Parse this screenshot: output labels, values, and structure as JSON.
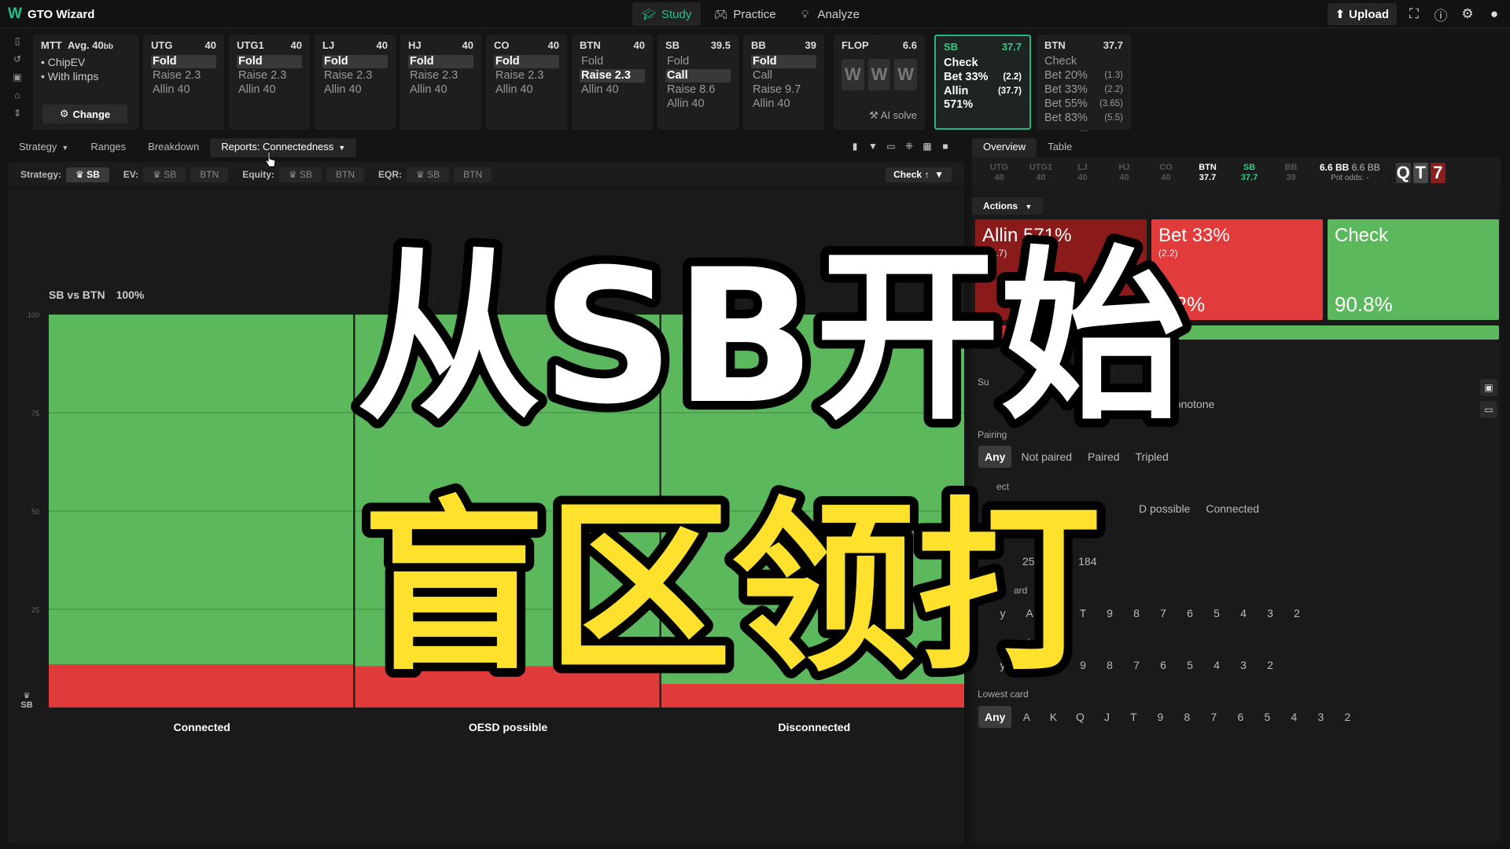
{
  "app": {
    "logo": "W",
    "title": "GTO Wizard"
  },
  "nav": [
    {
      "label": "Study",
      "icon": "graduation-cap-icon",
      "active": true
    },
    {
      "label": "Practice",
      "icon": "gamepad-icon",
      "active": false
    },
    {
      "label": "Analyze",
      "icon": "lightbulb-icon",
      "active": false
    }
  ],
  "topbar": {
    "upload": "Upload"
  },
  "mtt": {
    "title": "MTT",
    "avg": "Avg. 40",
    "avg_unit": "bb",
    "opt1": "ChipEV",
    "opt2": "With limps",
    "change": "Change"
  },
  "positions": [
    {
      "name": "UTG",
      "stack": "40",
      "actions": [
        "Fold",
        "Raise 2.3",
        "Allin 40"
      ],
      "selected": 0
    },
    {
      "name": "UTG1",
      "stack": "40",
      "actions": [
        "Fold",
        "Raise 2.3",
        "Allin 40"
      ],
      "selected": 0
    },
    {
      "name": "LJ",
      "stack": "40",
      "actions": [
        "Fold",
        "Raise 2.3",
        "Allin 40"
      ],
      "selected": 0
    },
    {
      "name": "HJ",
      "stack": "40",
      "actions": [
        "Fold",
        "Raise 2.3",
        "Allin 40"
      ],
      "selected": 0
    },
    {
      "name": "CO",
      "stack": "40",
      "actions": [
        "Fold",
        "Raise 2.3",
        "Allin 40"
      ],
      "selected": 0
    },
    {
      "name": "BTN",
      "stack": "40",
      "actions": [
        "Fold",
        "Raise 2.3",
        "Allin 40"
      ],
      "selected": 1
    },
    {
      "name": "SB",
      "stack": "39.5",
      "actions": [
        "Fold",
        "Call",
        "Raise 8.6",
        "Allin 40"
      ],
      "selected": 1
    },
    {
      "name": "BB",
      "stack": "39",
      "actions": [
        "Fold",
        "Call",
        "Raise 9.7",
        "Allin 40"
      ],
      "selected": 0
    }
  ],
  "flop": {
    "label": "FLOP",
    "pot": "6.6",
    "cards": [
      "W",
      "W",
      "W"
    ],
    "ai": "AI solve"
  },
  "sb_node": {
    "name": "SB",
    "stack": "37.7",
    "actions": [
      {
        "label": "Check",
        "sub": ""
      },
      {
        "label": "Bet 33%",
        "sub": "(2.2)"
      },
      {
        "label": "Allin 571%",
        "sub": "(37.7)"
      }
    ]
  },
  "btn_node": {
    "name": "BTN",
    "stack": "37.7",
    "actions": [
      {
        "label": "Check",
        "sub": ""
      },
      {
        "label": "Bet 20%",
        "sub": "(1.3)"
      },
      {
        "label": "Bet 33%",
        "sub": "(2.2)"
      },
      {
        "label": "Bet 55%",
        "sub": "(3.65)"
      },
      {
        "label": "Bet 83%",
        "sub": "(5.5)"
      }
    ],
    "more": "..."
  },
  "subnav": [
    "Strategy",
    "Ranges",
    "Breakdown",
    "Reports: Connectedness"
  ],
  "filterbar": {
    "strategy_label": "Strategy:",
    "strategy_opts": [
      "SB"
    ],
    "ev_label": "EV:",
    "ev_opts": [
      "SB",
      "BTN"
    ],
    "equity_label": "Equity:",
    "equity_opts": [
      "SB",
      "BTN"
    ],
    "eqr_label": "EQR:",
    "eqr_opts": [
      "SB",
      "BTN"
    ],
    "check_dd": "Check"
  },
  "chart_data": {
    "type": "bar",
    "stacked": true,
    "title": "SB vs BTN",
    "filter_pct": "100%",
    "categories": [
      "Connected",
      "OESD possible",
      "Disconnected"
    ],
    "ylim": [
      0,
      100
    ],
    "yticks": [
      "100",
      "75",
      "50",
      "25"
    ],
    "player_label": "SB",
    "series": [
      {
        "name": "Allin 571%",
        "color": "#8b1a1a",
        "values": [
          0,
          0,
          0
        ]
      },
      {
        "name": "Bet 33%",
        "color": "#e03a3a",
        "values": [
          11,
          10.5,
          6
        ]
      },
      {
        "name": "Check",
        "color": "#5cb85c",
        "values": [
          89,
          89.5,
          94
        ]
      }
    ],
    "grid": true
  },
  "right_panel": {
    "tabs": [
      "Overview",
      "Table"
    ],
    "strip": [
      {
        "pos": "UTG",
        "stack": "40"
      },
      {
        "pos": "UTG1",
        "stack": "40"
      },
      {
        "pos": "LJ",
        "stack": "40"
      },
      {
        "pos": "HJ",
        "stack": "40"
      },
      {
        "pos": "CO",
        "stack": "40"
      },
      {
        "pos": "BTN",
        "stack": "37.7"
      },
      {
        "pos": "SB",
        "stack": "37.7"
      },
      {
        "pos": "BB",
        "stack": "39"
      }
    ],
    "pot": {
      "left": "6.6 BB",
      "right": "6.6 BB",
      "odds": "Pot odds: -"
    },
    "board": [
      "Q",
      "T",
      "7"
    ],
    "actions_dd": "Actions",
    "action_boxes": [
      {
        "name": "Allin 571%",
        "size": "(37.7)",
        "pct": "",
        "color": "#8b1a1a"
      },
      {
        "name": "Bet 33%",
        "size": "(2.2)",
        "pct": "9.2%",
        "color": "#e23b3b"
      },
      {
        "name": "Check",
        "size": "",
        "pct": "90.8%",
        "color": "#5cb85c"
      }
    ],
    "filter_btn": "Filter",
    "suits": {
      "label": "Su",
      "options": [
        "w",
        "Monotone"
      ]
    },
    "pairing": {
      "label": "Pairing",
      "options": [
        "Any",
        "Not paired",
        "Paired",
        "Tripled"
      ]
    },
    "connect": {
      "label": "ect",
      "options": [
        "D possible",
        "Connected"
      ]
    },
    "counts": [
      "25",
      "49",
      "184"
    ],
    "highest": {
      "label": "ard",
      "options": [
        "y",
        "A",
        "K",
        "T",
        "9",
        "8",
        "7",
        "6",
        "5",
        "4",
        "3",
        "2"
      ]
    },
    "middle": {
      "label": "e card",
      "options": [
        "y",
        "A",
        "T",
        "9",
        "8",
        "7",
        "6",
        "5",
        "4",
        "3",
        "2"
      ]
    },
    "lowest": {
      "label": "Lowest card",
      "options": [
        "Any",
        "A",
        "K",
        "Q",
        "J",
        "T",
        "9",
        "8",
        "7",
        "6",
        "5",
        "4",
        "3",
        "2"
      ]
    }
  },
  "overlay": {
    "line1": "从SB开始",
    "line2": "盲区领打"
  }
}
